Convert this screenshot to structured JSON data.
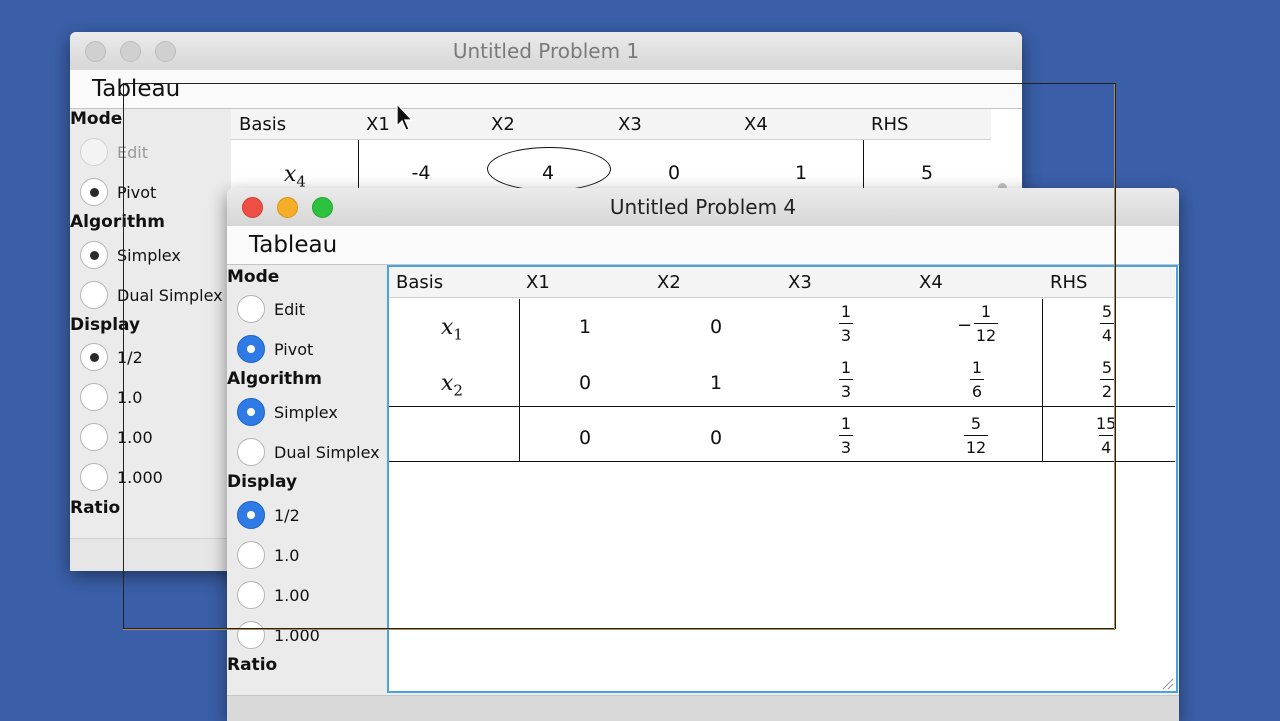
{
  "back_window": {
    "title": "Untitled Problem 1",
    "tab": "Tableau",
    "mode_label": "Mode",
    "mode_options": [
      "Edit",
      "Pivot"
    ],
    "algorithm_label": "Algorithm",
    "algorithm_options": [
      "Simplex",
      "Dual Simplex"
    ],
    "display_label": "Display",
    "display_options": [
      "1/2",
      "1.0",
      "1.00",
      "1.000"
    ],
    "ratio_label": "Ratio",
    "columns": [
      "Basis",
      "X1",
      "X2",
      "X3",
      "X4",
      "RHS"
    ],
    "row": {
      "basis_var": "x",
      "basis_sub": "4",
      "values": [
        "-4",
        "4",
        "0",
        "1",
        "5"
      ]
    },
    "selected_mode": "Pivot",
    "selected_algorithm": "Simplex",
    "selected_display": "1/2"
  },
  "front_window": {
    "title": "Untitled Problem 4",
    "tab": "Tableau",
    "mode_label": "Mode",
    "mode_options": [
      "Edit",
      "Pivot"
    ],
    "algorithm_label": "Algorithm",
    "algorithm_options": [
      "Simplex",
      "Dual Simplex"
    ],
    "display_label": "Display",
    "display_options": [
      "1/2",
      "1.0",
      "1.00",
      "1.000"
    ],
    "ratio_label": "Ratio",
    "selected_mode": "Pivot",
    "selected_algorithm": "Simplex",
    "selected_display": "1/2",
    "columns": [
      "Basis",
      "X1",
      "X2",
      "X3",
      "X4",
      "RHS"
    ],
    "rows": [
      {
        "basis_var": "x",
        "basis_sub": "1",
        "x1": "1",
        "x2": "0",
        "x3": {
          "num": "1",
          "den": "3"
        },
        "x4": {
          "sign": "−",
          "num": "1",
          "den": "12"
        },
        "rhs": {
          "num": "5",
          "den": "4"
        }
      },
      {
        "basis_var": "x",
        "basis_sub": "2",
        "x1": "0",
        "x2": "1",
        "x3": {
          "num": "1",
          "den": "3"
        },
        "x4": {
          "num": "1",
          "den": "6"
        },
        "rhs": {
          "num": "5",
          "den": "2"
        }
      },
      {
        "basis_var": "",
        "basis_sub": "",
        "x1": "0",
        "x2": "0",
        "x3": {
          "num": "1",
          "den": "3"
        },
        "x4": {
          "num": "5",
          "den": "12"
        },
        "rhs": {
          "num": "15",
          "den": "4"
        }
      }
    ]
  },
  "colors": {
    "desktop": "#3a5fa8",
    "radio_selected": "#2f7ae5",
    "table_focus_border": "#4aa3df",
    "traffic_close": "#ee4f44",
    "traffic_minimize": "#f6ae29",
    "traffic_zoom": "#2cc23f"
  }
}
